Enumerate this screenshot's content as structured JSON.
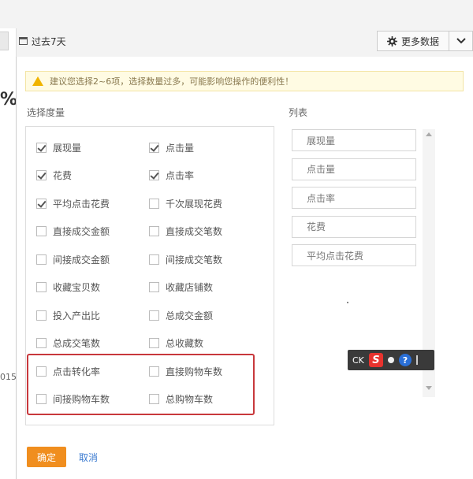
{
  "toolbar": {
    "date_range": "过去7天",
    "more_data": "更多数据",
    "calendar_icon": "calendar-icon",
    "gear_icon": "gear-icon",
    "caret_icon": "chevron-down-icon"
  },
  "background": {
    "percent_glyph": "%",
    "cut_text": "015-"
  },
  "warning": {
    "text": "建议您选择2~6项，选择数量过多，可能影响您操作的便利性！",
    "icon": "warning-icon",
    "color": "#f0b400"
  },
  "metrics": {
    "label": "选择度量",
    "items": [
      {
        "label": "展现量",
        "checked": true
      },
      {
        "label": "点击量",
        "checked": true
      },
      {
        "label": "花费",
        "checked": true
      },
      {
        "label": "点击率",
        "checked": true
      },
      {
        "label": "平均点击花费",
        "checked": true
      },
      {
        "label": "千次展现花费",
        "checked": false
      },
      {
        "label": "直接成交金额",
        "checked": false
      },
      {
        "label": "直接成交笔数",
        "checked": false
      },
      {
        "label": "间接成交金额",
        "checked": false
      },
      {
        "label": "间接成交笔数",
        "checked": false
      },
      {
        "label": "收藏宝贝数",
        "checked": false
      },
      {
        "label": "收藏店铺数",
        "checked": false
      },
      {
        "label": "投入产出比",
        "checked": false
      },
      {
        "label": "总成交金额",
        "checked": false
      },
      {
        "label": "总成交笔数",
        "checked": false
      },
      {
        "label": "总收藏数",
        "checked": false
      },
      {
        "label": "点击转化率",
        "checked": false
      },
      {
        "label": "直接购物车数",
        "checked": false
      },
      {
        "label": "间接购物车数",
        "checked": false
      },
      {
        "label": "总购物车数",
        "checked": false
      }
    ]
  },
  "columns": {
    "label": "列表",
    "items": [
      "展现量",
      "点击量",
      "点击率",
      "花费",
      "平均点击花费"
    ]
  },
  "ime_toolbar": {
    "text": "CK",
    "logo": "S"
  },
  "actions": {
    "ok": "确定",
    "cancel": "取消"
  },
  "colors": {
    "primary": "#f08e1f",
    "highlight_border": "#c8383c",
    "link": "#3a7ad0"
  }
}
